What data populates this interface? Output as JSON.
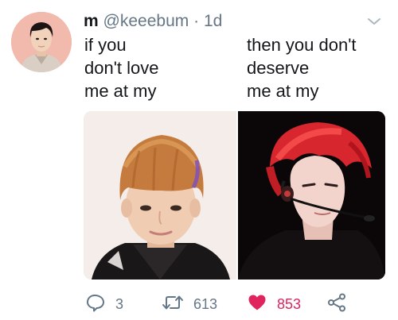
{
  "tweet": {
    "display_name": "m",
    "handle": "@keeebum",
    "separator": "·",
    "time": "1d",
    "text_left": [
      "if you",
      "don't love",
      "me at my"
    ],
    "text_right": [
      "then you don't",
      "deserve",
      "me at my"
    ]
  },
  "actions": {
    "reply_count": "3",
    "retweet_count": "613",
    "like_count": "853"
  },
  "icons": {
    "reply": "reply-icon",
    "retweet": "retweet-icon",
    "like": "heart-icon",
    "share": "share-icon",
    "menu": "chevron-down-icon"
  },
  "colors": {
    "text": "#14171a",
    "muted": "#657786",
    "like": "#e0245e"
  }
}
